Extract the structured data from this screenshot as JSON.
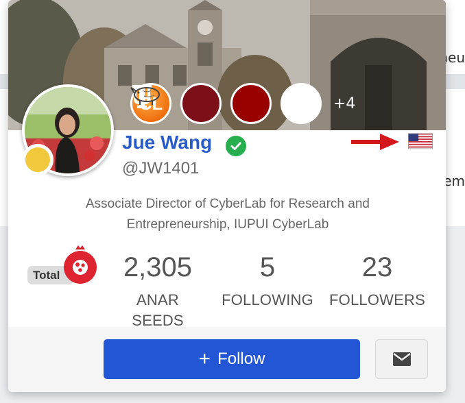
{
  "background": {
    "right_text_top": "neu",
    "right_text_mid": "em"
  },
  "badges": {
    "cl_text": "CL",
    "more_label": "+4"
  },
  "profile": {
    "name": "Jue Wang",
    "handle": "@JW1401",
    "bio_line1": "Associate Director of CyberLab for Research and",
    "bio_line2": "Entrepreneurship, IUPUI CyberLab",
    "flag_icon": "us-flag-icon",
    "status_color": "#f2c93c",
    "verified_color": "#27ae4f"
  },
  "stats": {
    "total_label": "Total",
    "items": [
      {
        "value": "2,305",
        "label": "ANAR SEEDS"
      },
      {
        "value": "5",
        "label": "FOLLOWING"
      },
      {
        "value": "23",
        "label": "FOLLOWERS"
      }
    ]
  },
  "actions": {
    "follow_label": "Follow",
    "follow_color": "#2256d4",
    "message_icon": "envelope-icon"
  }
}
